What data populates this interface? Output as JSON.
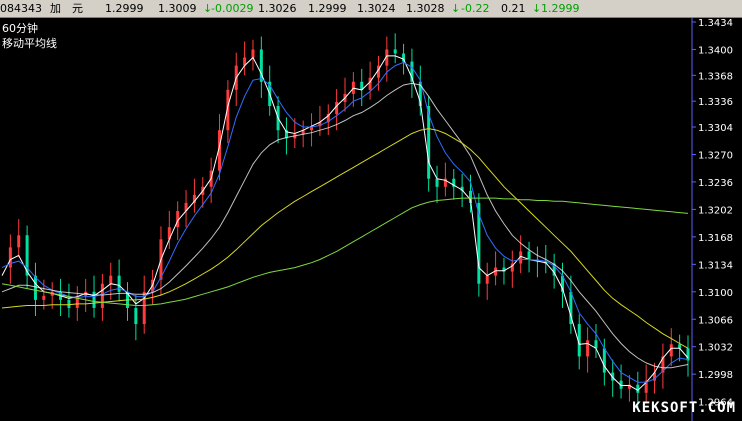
{
  "quote_bar": {
    "code": "084343",
    "name": "加　元",
    "open": "1.2999",
    "high": "1.3009",
    "change": "-0.0029",
    "low": "1.3026",
    "prev": "1.2999",
    "bid": "1.3024",
    "ask": "1.3028",
    "pct": "-0.22",
    "spread": "0.21",
    "last": "1.2999",
    "down_arrow": "↓",
    "down_color": "#00a000"
  },
  "panel": {
    "period": "60分钟",
    "indicator": "移动平均线"
  },
  "watermark": "KEKSOFT.COM",
  "colors": {
    "background": "#000000",
    "up_candle": "#ff3b3b",
    "down_candle": "#00e0a0",
    "ma_white": "#ffffff",
    "ma_yellow": "#d8d820",
    "ma_blue": "#2f6fff",
    "ma_green": "#80d840",
    "axis_line": "#6060ff"
  },
  "chart_data": {
    "type": "line",
    "ylim": [
      1.2945,
      1.3434
    ],
    "ytick_labels": [
      "1.3434",
      "1.3400",
      "1.3368",
      "1.3336",
      "1.3304",
      "1.3270",
      "1.3236",
      "1.3202",
      "1.3168",
      "1.3134",
      "1.3100",
      "1.3066",
      "1.3032",
      "1.2998",
      "1.2964"
    ],
    "yticks": [
      1.3434,
      1.34,
      1.3368,
      1.3336,
      1.3304,
      1.327,
      1.3236,
      1.3202,
      1.3168,
      1.3134,
      1.31,
      1.3066,
      1.3032,
      1.2998,
      1.2964
    ],
    "price": [
      1.313,
      1.3155,
      1.317,
      1.312,
      1.309,
      1.3095,
      1.31,
      1.309,
      1.308,
      1.3095,
      1.31,
      1.308,
      1.311,
      1.312,
      1.31,
      1.308,
      1.306,
      1.31,
      1.3115,
      1.3165,
      1.318,
      1.32,
      1.321,
      1.322,
      1.323,
      1.325,
      1.33,
      1.335,
      1.338,
      1.339,
      1.34,
      1.336,
      1.333,
      1.33,
      1.329,
      1.3295,
      1.33,
      1.3305,
      1.331,
      1.332,
      1.3335,
      1.3345,
      1.336,
      1.335,
      1.3365,
      1.338,
      1.34,
      1.3395,
      1.3385,
      1.336,
      1.333,
      1.324,
      1.323,
      1.324,
      1.323,
      1.3225,
      1.321,
      1.311,
      1.312,
      1.313,
      1.3125,
      1.3135,
      1.315,
      1.314,
      1.3138,
      1.3135,
      1.312,
      1.31,
      1.306,
      1.302,
      1.304,
      1.303,
      1.3,
      1.299,
      1.298,
      1.2985,
      1.2975,
      1.299,
      1.3,
      1.302,
      1.3035,
      1.303,
      1.3015
    ],
    "series": [
      {
        "values": [
          1.312,
          1.314,
          1.3145,
          1.3125,
          1.311,
          1.31,
          1.3098,
          1.3095,
          1.3092,
          1.3094,
          1.3098,
          1.3095,
          1.3102,
          1.311,
          1.3108,
          1.3098,
          1.3085,
          1.3092,
          1.3108,
          1.314,
          1.3165,
          1.3188,
          1.32,
          1.3212,
          1.3225,
          1.324,
          1.328,
          1.333,
          1.3365,
          1.338,
          1.339,
          1.337,
          1.3345,
          1.3315,
          1.3298,
          1.3296,
          1.33,
          1.3305,
          1.331,
          1.3318,
          1.333,
          1.334,
          1.3352,
          1.335,
          1.336,
          1.3375,
          1.3392,
          1.3392,
          1.3388,
          1.3365,
          1.3335,
          1.326,
          1.324,
          1.3238,
          1.3232,
          1.3226,
          1.3214,
          1.313,
          1.312,
          1.3126,
          1.3126,
          1.3132,
          1.3144,
          1.314,
          1.3138,
          1.3136,
          1.3124,
          1.3104,
          1.307,
          1.3035,
          1.3036,
          1.303,
          1.3008,
          1.2994,
          1.2984,
          1.2984,
          1.2978,
          1.2988,
          1.3,
          1.3018,
          1.303,
          1.303,
          1.3018
        ]
      },
      {
        "values": [
          1.313,
          1.3135,
          1.3138,
          1.313,
          1.3118,
          1.3108,
          1.3102,
          1.3098,
          1.3094,
          1.3093,
          1.3094,
          1.3094,
          1.3097,
          1.3102,
          1.3104,
          1.31,
          1.3094,
          1.3094,
          1.31,
          1.3118,
          1.3138,
          1.316,
          1.3178,
          1.3194,
          1.3208,
          1.3222,
          1.3246,
          1.328,
          1.3316,
          1.3342,
          1.3362,
          1.3364,
          1.3356,
          1.3338,
          1.3322,
          1.331,
          1.3304,
          1.3304,
          1.3306,
          1.3311,
          1.3318,
          1.3326,
          1.3336,
          1.334,
          1.3348,
          1.3358,
          1.3372,
          1.338,
          1.3384,
          1.3378,
          1.3362,
          1.332,
          1.3292,
          1.3272,
          1.3258,
          1.3248,
          1.3236,
          1.3196,
          1.317,
          1.3154,
          1.3144,
          1.3138,
          1.314,
          1.314,
          1.3139,
          1.3138,
          1.3132,
          1.312,
          1.31,
          1.3074,
          1.306,
          1.3048,
          1.303,
          1.3014,
          1.3,
          1.2994,
          1.2988,
          1.2988,
          1.2992,
          1.3002,
          1.3012,
          1.3018,
          1.3016
        ]
      },
      {
        "values": [
          1.31,
          1.3104,
          1.3108,
          1.3108,
          1.3106,
          1.3104,
          1.3102,
          1.31,
          1.3099,
          1.3098,
          1.3097,
          1.3096,
          1.3096,
          1.3097,
          1.3098,
          1.3098,
          1.3097,
          1.3097,
          1.3099,
          1.3104,
          1.3112,
          1.3122,
          1.3132,
          1.3143,
          1.3154,
          1.3166,
          1.318,
          1.3198,
          1.3218,
          1.3238,
          1.3258,
          1.3272,
          1.3282,
          1.3288,
          1.3291,
          1.3293,
          1.3295,
          1.3297,
          1.33,
          1.3303,
          1.3307,
          1.3312,
          1.3318,
          1.3322,
          1.3328,
          1.3335,
          1.3343,
          1.335,
          1.3356,
          1.3358,
          1.3356,
          1.3342,
          1.3326,
          1.3312,
          1.3298,
          1.3284,
          1.3268,
          1.3244,
          1.322,
          1.32,
          1.3184,
          1.317,
          1.316,
          1.3152,
          1.3145,
          1.314,
          1.3134,
          1.3126,
          1.3114,
          1.31,
          1.3088,
          1.3076,
          1.3062,
          1.3048,
          1.3036,
          1.3026,
          1.3018,
          1.3012,
          1.3008,
          1.3006,
          1.3006,
          1.3008,
          1.301
        ]
      },
      {
        "values": [
          1.308,
          1.3081,
          1.3082,
          1.3083,
          1.3083,
          1.3083,
          1.3084,
          1.3084,
          1.3084,
          1.3085,
          1.3085,
          1.3086,
          1.3087,
          1.3088,
          1.3089,
          1.309,
          1.309,
          1.3091,
          1.3093,
          1.3096,
          1.31,
          1.3105,
          1.311,
          1.3116,
          1.3122,
          1.3128,
          1.3135,
          1.3143,
          1.3152,
          1.3162,
          1.3172,
          1.3182,
          1.319,
          1.3198,
          1.3205,
          1.3212,
          1.3218,
          1.3224,
          1.323,
          1.3236,
          1.3242,
          1.3248,
          1.3254,
          1.326,
          1.3266,
          1.3272,
          1.3278,
          1.3284,
          1.329,
          1.3296,
          1.33,
          1.3302,
          1.33,
          1.3296,
          1.329,
          1.3284,
          1.3276,
          1.3266,
          1.3254,
          1.3242,
          1.323,
          1.322,
          1.321,
          1.32,
          1.319,
          1.318,
          1.317,
          1.316,
          1.315,
          1.3138,
          1.3126,
          1.3114,
          1.3102,
          1.3092,
          1.3084,
          1.3077,
          1.307,
          1.3062,
          1.3055,
          1.3048,
          1.3042,
          1.3036,
          1.303
        ]
      },
      {
        "values": [
          1.311,
          1.3108,
          1.3106,
          1.3104,
          1.3102,
          1.31,
          1.3098,
          1.3096,
          1.3094,
          1.3092,
          1.309,
          1.3088,
          1.3087,
          1.3086,
          1.3085,
          1.3084,
          1.3083,
          1.3083,
          1.3084,
          1.3085,
          1.3087,
          1.3089,
          1.3091,
          1.3094,
          1.3097,
          1.31,
          1.3103,
          1.3106,
          1.311,
          1.3114,
          1.3118,
          1.3121,
          1.3124,
          1.3126,
          1.3128,
          1.313,
          1.3133,
          1.3136,
          1.314,
          1.3145,
          1.315,
          1.3156,
          1.3162,
          1.3168,
          1.3174,
          1.318,
          1.3186,
          1.3192,
          1.3198,
          1.3204,
          1.3208,
          1.3211,
          1.3213,
          1.3214,
          1.3215,
          1.3216,
          1.3216,
          1.3216,
          1.3216,
          1.3216,
          1.3215,
          1.3215,
          1.3214,
          1.3214,
          1.3213,
          1.3213,
          1.3212,
          1.3212,
          1.3211,
          1.321,
          1.3209,
          1.3208,
          1.3207,
          1.3206,
          1.3205,
          1.3204,
          1.3203,
          1.3202,
          1.3201,
          1.32,
          1.3199,
          1.3198,
          1.3197
        ]
      }
    ]
  }
}
